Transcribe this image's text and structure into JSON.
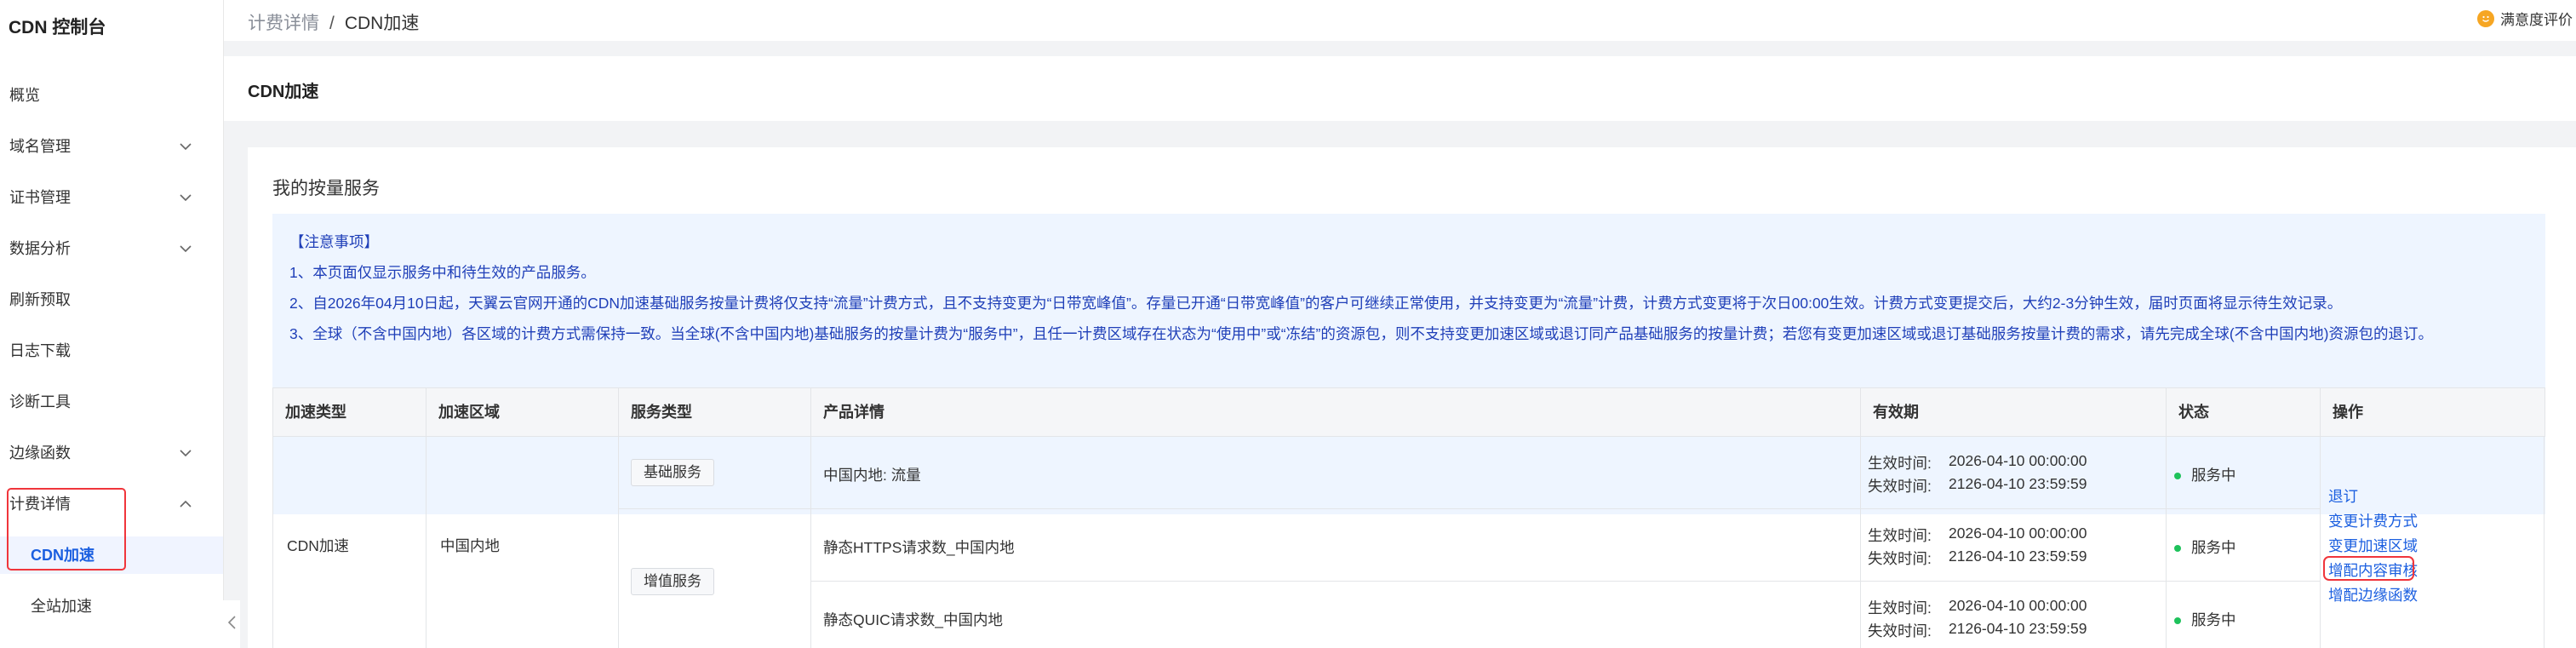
{
  "sidebar": {
    "title": "CDN 控制台",
    "items": [
      {
        "label": "概览",
        "expandable": false
      },
      {
        "label": "域名管理",
        "expandable": true
      },
      {
        "label": "证书管理",
        "expandable": true
      },
      {
        "label": "数据分析",
        "expandable": true
      },
      {
        "label": "刷新预取",
        "expandable": false
      },
      {
        "label": "日志下载",
        "expandable": false
      },
      {
        "label": "诊断工具",
        "expandable": false
      },
      {
        "label": "边缘函数",
        "expandable": true
      },
      {
        "label": "计费详情",
        "expandable": true,
        "expanded": true
      },
      {
        "label": "CDN加速",
        "sub": true,
        "active": true
      },
      {
        "label": "全站加速",
        "sub": true
      }
    ]
  },
  "header": {
    "breadcrumb": [
      "计费详情",
      "CDN加速"
    ],
    "separator": "/",
    "survey": "满意度评价"
  },
  "page": {
    "title": "CDN加速"
  },
  "card": {
    "title": "我的按量服务",
    "notice": [
      "【注意事项】",
      "1、本页面仅显示服务中和待生效的产品服务。",
      "2、自2026年04月10日起，天翼云官网开通的CDN加速基础服务按量计费将仅支持“流量”计费方式，且不支持变更为“日带宽峰值”。存量已开通“日带宽峰值”的客户可继续正常使用，并支持变更为“流量”计费，计费方式变更将于次日00:00生效。计费方式变更提交后，大约2-3分钟生效，届时页面将显示待生效记录。",
      "3、全球（不含中国内地）各区域的计费方式需保持一致。当全球(不含中国内地)基础服务的按量计费为“服务中”，且任一计费区域存在状态为“使用中”或“冻结”的资源包，则不支持变更加速区域或退订同产品基础服务的按量计费；若您有变更加速区域或退订基础服务按量计费的需求，请先完成全球(不含中国内地)资源包的退订。"
    ]
  },
  "table": {
    "headers": [
      "加速类型",
      "加速区域",
      "服务类型",
      "产品详情",
      "有效期",
      "状态",
      "操作"
    ],
    "accel_type": "CDN加速",
    "accel_region": "中国内地",
    "service_types": [
      "基础服务",
      "增值服务"
    ],
    "rows": [
      {
        "product": "中国内地: 流量",
        "start_label": "生效时间:",
        "start": "2026-04-10 00:00:00",
        "end_label": "失效时间:",
        "end": "2126-04-10 23:59:59",
        "status": "服务中"
      },
      {
        "product": "静态HTTPS请求数_中国内地",
        "start_label": "生效时间:",
        "start": "2026-04-10 00:00:00",
        "end_label": "失效时间:",
        "end": "2126-04-10 23:59:59",
        "status": "服务中"
      },
      {
        "product": "静态QUIC请求数_中国内地",
        "start_label": "生效时间:",
        "start": "2026-04-10 00:00:00",
        "end_label": "失效时间:",
        "end": "2126-04-10 23:59:59",
        "status": "服务中"
      }
    ],
    "operations": [
      "退订",
      "变更计费方式",
      "变更加速区域",
      "增配内容审核",
      "增配边缘函数"
    ]
  },
  "colors": {
    "accent": "#1b5fe0",
    "highlight": "#f0353b",
    "notice_bg": "#eef5ff",
    "status_ok": "#1ec25b"
  }
}
